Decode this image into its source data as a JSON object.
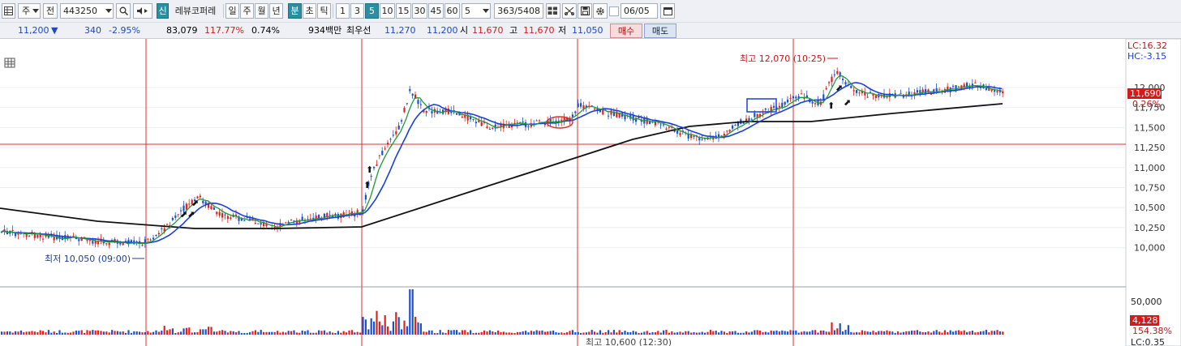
{
  "toolbar": {
    "type_label": "주",
    "prev_label": "전",
    "code_value": "443250",
    "new_label": "신",
    "stock_name": "레뷰코퍼레",
    "period_day": "일",
    "period_week": "주",
    "period_month": "월",
    "period_year": "년",
    "period_minute": "분",
    "period_second": "초",
    "period_tick": "틱",
    "intervals": [
      "1",
      "3",
      "5",
      "10",
      "15",
      "30",
      "45",
      "60"
    ],
    "active_interval": "5",
    "custom_interval": "5",
    "count_value": "363/5408",
    "date_value": "06/05"
  },
  "quote": {
    "price": "11,200",
    "direction": "▼",
    "change": "340",
    "change_pct": "-2.95%",
    "volume": "83,079",
    "volume_ratio": "117.77%",
    "turnover": "0.74%",
    "amount": "934백만",
    "best_bid_label": "최우선",
    "best_ask": "11,270",
    "best_bid": "11,200",
    "open_label": "시",
    "open": "11,670",
    "high_label": "고",
    "high": "11,670",
    "low_label": "저",
    "low": "11,050",
    "buy_label": "매수",
    "sell_label": "매도"
  },
  "chart": {
    "lc_label": "LC:16.32",
    "hc_label": "HC:-3.15",
    "current_price_label": "11,690",
    "current_pct_label": "0.26%",
    "high_annotation": "최고 12,070 (10:25)",
    "low_annotation": "최저 10,050 (09:00)",
    "bottom_annotation": "최고 10,600 (12:30)",
    "volume_label": "4,128",
    "volume_pct_label": "154.38%",
    "bottom_right_label": "LC:0.35",
    "volume_axis_label": "50,000",
    "price_ticks": [
      "12,000",
      "11,750",
      "11,500",
      "11,250",
      "11,000",
      "10,750",
      "10,500",
      "10,250",
      "10,000"
    ]
  },
  "colors": {
    "up": "#e0211d",
    "down": "#1f4fc9",
    "ma_short": "#1f9a3a",
    "ma_mid": "#1a3fd8",
    "ma_long": "#111111",
    "day_divider": "#e03030",
    "toolbar_active": "#2a8fa3"
  },
  "icons": [
    "chevron-down-icon",
    "search-icon",
    "speaker-icon",
    "arrow-right-icon",
    "grid-icon",
    "scissors-icon",
    "save-icon",
    "gear-icon",
    "calendar-icon",
    "table-icon"
  ]
}
